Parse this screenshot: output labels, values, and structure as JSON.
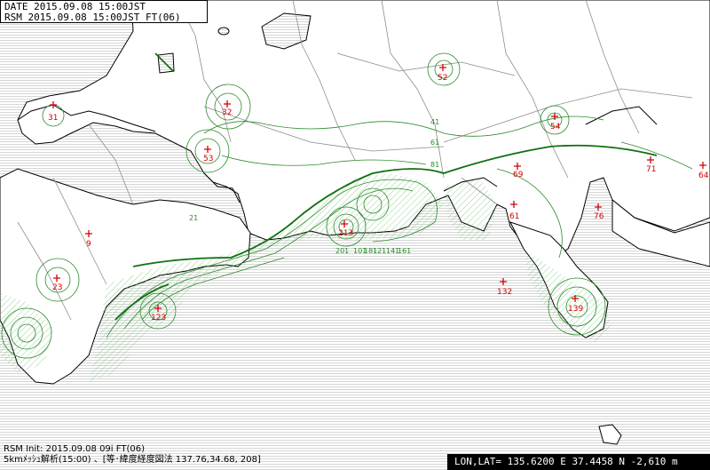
{
  "header": {
    "line1": "DATE 2015.09.08 15:00JST",
    "line2": "RSM  2015.09.08 15:00JST FT(06)"
  },
  "footer": {
    "init_line": "RSM Init: 2015.09.08 09i FT(06)",
    "method_line": "5kmﾒｯｼｭ解析(15:00) 、[等･緯度経度図法 137.76,34.68, 208]"
  },
  "coord_readout": "LON,LAT= 135.6200 E  37.4458 N  -2,610 m",
  "stations": [
    {
      "id": "31",
      "label": "31"
    },
    {
      "id": "32",
      "label": "32"
    },
    {
      "id": "52",
      "label": "52"
    },
    {
      "id": "53",
      "label": "53"
    },
    {
      "id": "54",
      "label": "54"
    },
    {
      "id": "9",
      "label": "9"
    },
    {
      "id": "23",
      "label": "23"
    },
    {
      "id": "69",
      "label": "69"
    },
    {
      "id": "61",
      "label": "61"
    },
    {
      "id": "71",
      "label": "71"
    },
    {
      "id": "64",
      "label": "64"
    },
    {
      "id": "76",
      "label": "76"
    },
    {
      "id": "132",
      "label": "132"
    },
    {
      "id": "139",
      "label": "139"
    },
    {
      "id": "123",
      "label": "123"
    },
    {
      "id": "213",
      "label": "213"
    }
  ],
  "contour_labels": [
    "21",
    "41",
    "61",
    "81",
    "101",
    "121",
    "141",
    "161",
    "181",
    "201"
  ],
  "colors": {
    "land": "#ffffff",
    "sea_hatch": "#b9b9b9",
    "coastline": "#000000",
    "prefecture_border": "#8c8c8c",
    "contour": "#2a8a2a",
    "contour_bold": "#107010",
    "station_marker": "#d40000"
  }
}
